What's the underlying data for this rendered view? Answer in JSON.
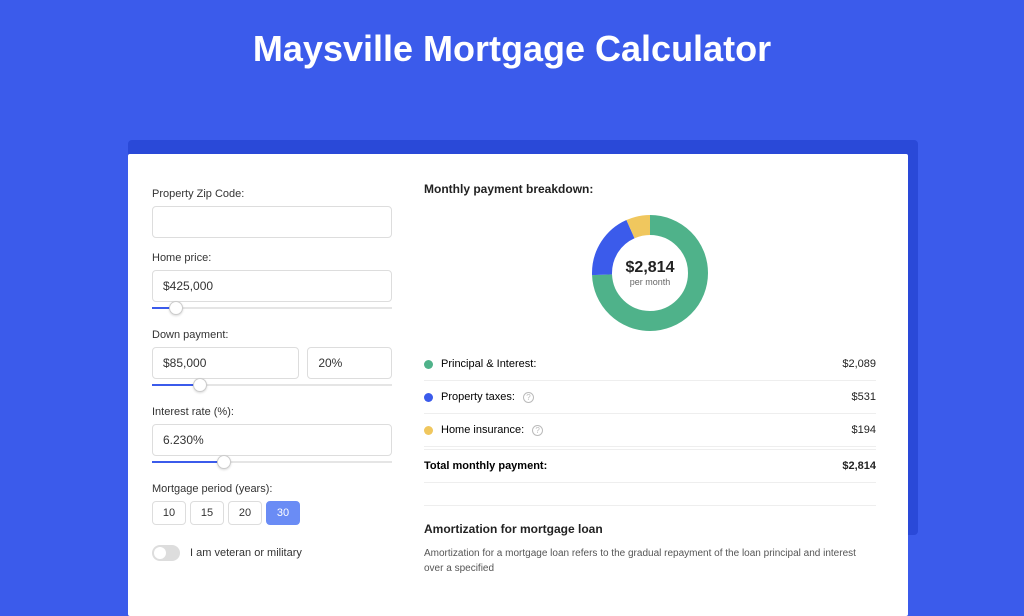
{
  "title": "Maysville Mortgage Calculator",
  "form": {
    "zip_label": "Property Zip Code:",
    "zip_value": "",
    "home_price_label": "Home price:",
    "home_price_value": "$425,000",
    "down_payment_label": "Down payment:",
    "down_payment_value": "$85,000",
    "down_payment_pct": "20%",
    "interest_label": "Interest rate (%):",
    "interest_value": "6.230%",
    "period_label": "Mortgage period (years):",
    "period_options": [
      "10",
      "15",
      "20",
      "30"
    ],
    "period_selected": "30",
    "veteran_label": "I am veteran or military"
  },
  "breakdown": {
    "title": "Monthly payment breakdown:",
    "total": "$2,814",
    "total_sub": "per month",
    "items": [
      {
        "label": "Principal & Interest:",
        "value": "$2,089"
      },
      {
        "label": "Property taxes:",
        "value": "$531"
      },
      {
        "label": "Home insurance:",
        "value": "$194"
      }
    ],
    "total_label": "Total monthly payment:",
    "total_value": "$2,814"
  },
  "amort": {
    "title": "Amortization for mortgage loan",
    "text": "Amortization for a mortgage loan refers to the gradual repayment of the loan principal and interest over a specified"
  },
  "chart_data": {
    "type": "pie",
    "title": "Monthly payment breakdown",
    "series": [
      {
        "name": "Principal & Interest",
        "value": 2089,
        "color": "#4fb28a"
      },
      {
        "name": "Property taxes",
        "value": 531,
        "color": "#3B5BEB"
      },
      {
        "name": "Home insurance",
        "value": 194,
        "color": "#f0c75e"
      }
    ],
    "total": 2814
  }
}
